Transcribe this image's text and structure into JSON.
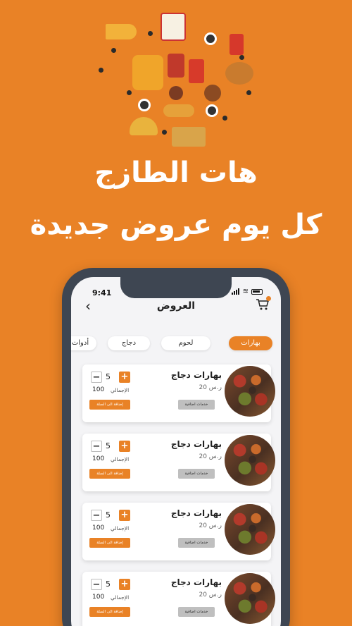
{
  "headline": {
    "line1": "هات الطازج",
    "line2": "كل يوم عروض جديدة"
  },
  "status_bar": {
    "time": "9:41"
  },
  "header": {
    "title": "العروض"
  },
  "tabs": [
    {
      "label": "بهارات",
      "active": true
    },
    {
      "label": "لحوم",
      "active": false
    },
    {
      "label": "دجاج",
      "active": false
    },
    {
      "label": "أدوات",
      "active": false
    }
  ],
  "products": [
    {
      "name": "بهارات دجاج",
      "price": "20 ر.س",
      "extra_label": "خدمات اضافية",
      "quantity": "5",
      "total_label": "الإجمالي",
      "total_value": "100",
      "add_label": "إضافة الى السلة"
    },
    {
      "name": "بهارات دجاج",
      "price": "20 ر.س",
      "extra_label": "خدمات اضافية",
      "quantity": "5",
      "total_label": "الإجمالي",
      "total_value": "100",
      "add_label": "إضافة الى السلة"
    },
    {
      "name": "بهارات دجاج",
      "price": "20 ر.س",
      "extra_label": "خدمات اضافية",
      "quantity": "5",
      "total_label": "الإجمالي",
      "total_value": "100",
      "add_label": "إضافة الى السلة"
    },
    {
      "name": "بهارات دجاج",
      "price": "20 ر.س",
      "extra_label": "خدمات اضافية",
      "quantity": "5",
      "total_label": "الإجمالي",
      "total_value": "100",
      "add_label": "إضافة الى السلة"
    }
  ],
  "colors": {
    "background": "#e98226",
    "accent": "#e98226",
    "phone_frame": "#3e4652"
  },
  "icons": {
    "back": "chevron-left-icon",
    "cart": "cart-icon",
    "plus": "plus-icon",
    "minus": "minus-icon"
  }
}
